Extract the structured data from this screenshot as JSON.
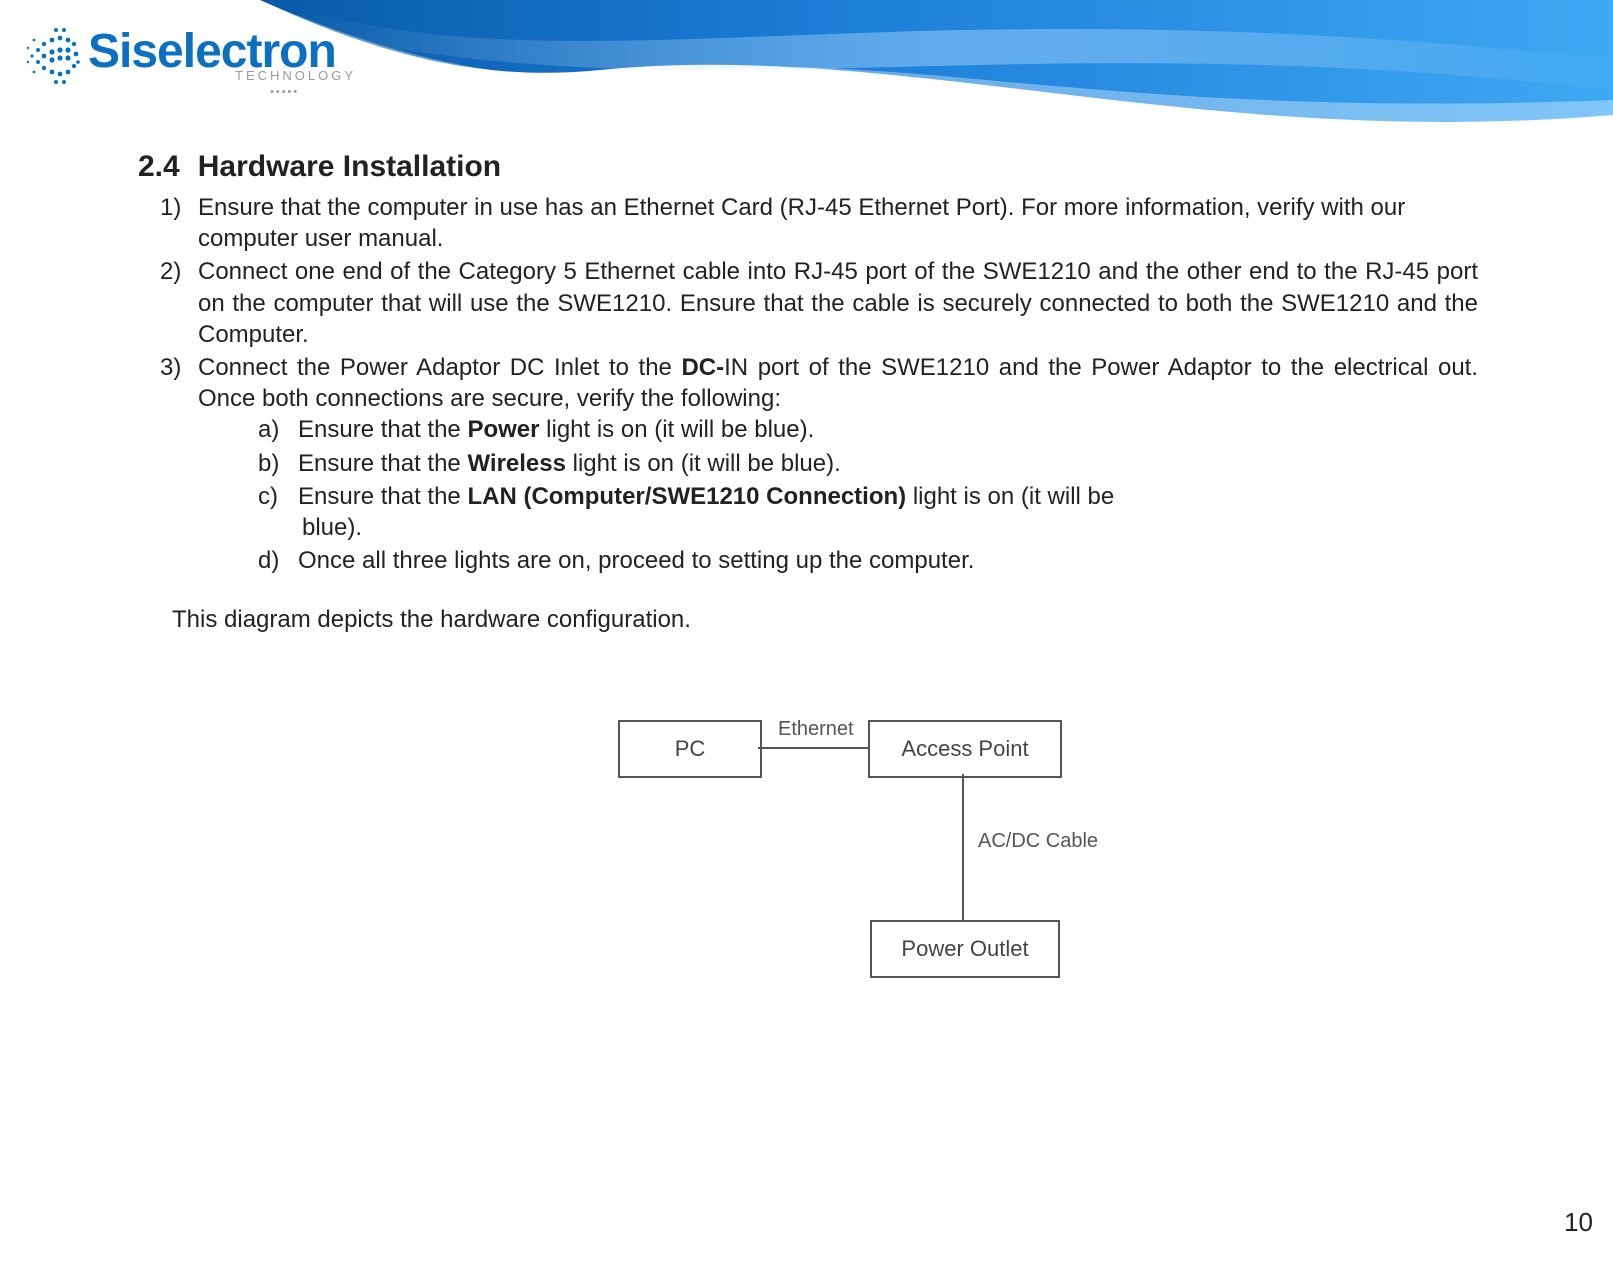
{
  "brand": {
    "name": "Siselectron",
    "sub": "TECHNOLOGY",
    "dots": "•••••"
  },
  "section": {
    "number": "2.4",
    "title": "Hardware Installation"
  },
  "items": {
    "i1": "Ensure that the computer in use has an Ethernet Card (RJ-45 Ethernet Port). For more information, verify with our computer user manual.",
    "i2": "Connect one end of the Category 5 Ethernet cable into RJ-45 port of the SWE1210 and the other end to the RJ-45 port on the computer that will use the SWE1210. Ensure that the cable is securely connected to both the SWE1210 and the Computer.",
    "i3_pre": "Connect the Power Adaptor DC Inlet to the ",
    "i3_bold": "DC-",
    "i3_post": "IN port of the SWE1210 and the Power Adaptor to the electrical out. Once both connections are secure, verify the following:"
  },
  "sub": {
    "a_pre": "Ensure that the ",
    "a_bold": "Power",
    "a_post": " light is on (it will be blue).",
    "b_pre": "Ensure that the ",
    "b_bold": "Wireless",
    "b_post": " light is on (it will be blue).",
    "c_pre": "Ensure that the ",
    "c_bold": "LAN (Computer/SWE1210 Connection)",
    "c_post": " light is on (it will be",
    "c_tail": "blue).",
    "d": "Once all three lights are on, proceed to setting up the computer."
  },
  "caption": "This diagram depicts the hardware configuration.",
  "diagram": {
    "pc": "PC",
    "ap": "Access Point",
    "po": "Power Outlet",
    "eth": "Ethernet",
    "ac": "AC/DC Cable"
  },
  "page": "10"
}
